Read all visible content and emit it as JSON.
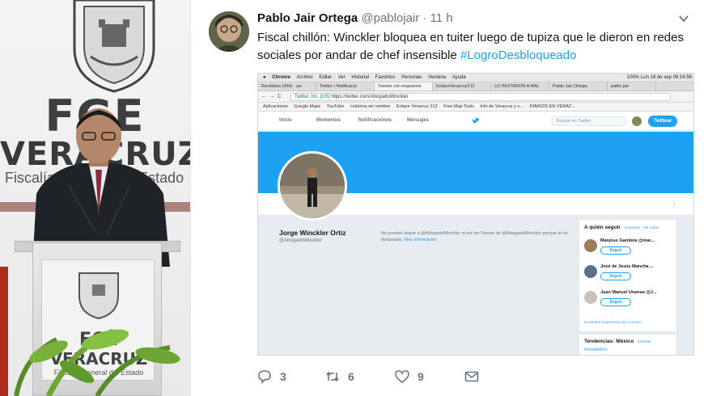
{
  "photo": {
    "fge_text": "FGE",
    "state_text": "VERACRUZ",
    "fiscalia_text": "Fiscalía General del Estado",
    "podium_fge": "FGE",
    "podium_state": "VERACRUZ",
    "podium_fiscalia": "Fiscalía General del Estado"
  },
  "tweet": {
    "author_name": "Pablo Jair Ortega",
    "author_handle": "@pablojair",
    "separator": "·",
    "time": "11 h",
    "text_body": "Fiscal chillón: Winckler bloquea en tuiter luego de tupiza que le dieron en redes sociales por andar de chef insensible ",
    "hashtag": "#LogroDesbloqueado",
    "reply_count": "3",
    "retweet_count": "6",
    "like_count": "9"
  },
  "screenshot": {
    "mac_menu": [
      "Chrome",
      "Archivo",
      "Editar",
      "Ver",
      "Historial",
      "Favoritos",
      "Personas",
      "Ventana",
      "Ayuda"
    ],
    "mac_status": "100%  Lun 18 de sep  08:16:58",
    "tabs": [
      "Recibidos (464) - pa",
      "Twitter / Notificacio",
      "Tweets con respuesta",
      "EnlaceVeracruz212",
      "LO INVITARON A MAL",
      "Pablo Jair Ortega"
    ],
    "tab_user": "pablo jair",
    "url_secure": "Twitter, Inc. [US]",
    "url_path": "https://twitter.com/AbogadoWinckler",
    "bookmarks": [
      "Aplicaciones",
      "Google Maps",
      "YouTube",
      "columna sin nombre",
      "Enlace Veracruz 212",
      "Free Map Tools",
      "Info de Veracruz y o...",
      "DIARIOS EN VERAC..."
    ],
    "nav": {
      "home": "Inicio",
      "moments": "Momentos",
      "notifications": "Notificaciones",
      "messages": "Mensajes"
    },
    "search_placeholder": "Buscar en Twitter",
    "tweet_button": "Twittear",
    "profile_name": "Jorge Winckler Ortiz",
    "profile_handle": "@AbogadoWinckler",
    "blocked_text": "No puedes seguir a @AbogadoWinckler ni ver los Tweets de @AbogadoWinckler porque te ha bloqueado.",
    "blocked_more": "Más información",
    "who_to_follow": "A quién seguir",
    "wtf_links": "· Actualizar · Ver todos",
    "suggestions": [
      {
        "name": "Manjose Gamboa @mar...",
        "follow": "Seguir"
      },
      {
        "name": "José de Jesús Mancha ...",
        "follow": "Seguir"
      },
      {
        "name": "Juan Manuel Unanue @J...",
        "follow": "Seguir"
      }
    ],
    "find_people": "Encuentra a personas que conoces",
    "trends_title": "Tendencias: México",
    "trends_change": "· Cambiar",
    "trend_1": "#noviaKIOn"
  },
  "colors": {
    "twitter_blue": "#1da1f2",
    "text": "#14171a",
    "muted": "#657786"
  }
}
